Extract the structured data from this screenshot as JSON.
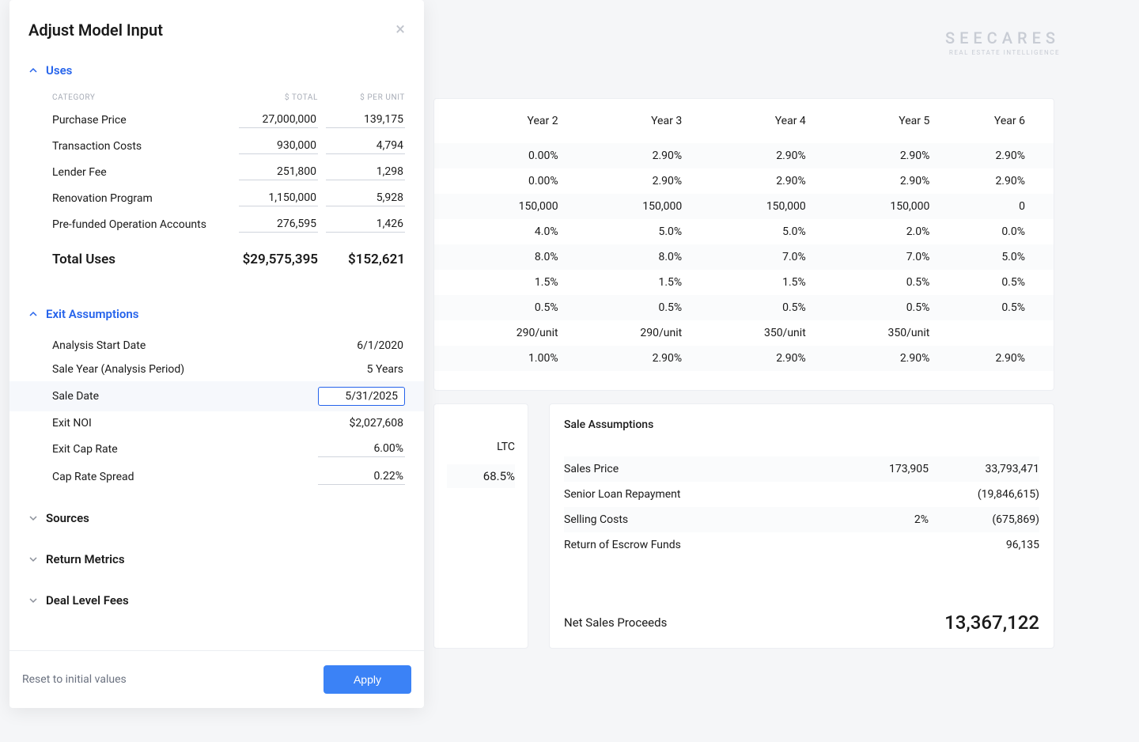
{
  "brand": {
    "name": "SEECARES",
    "tagline": "REAL ESTATE INTELLIGENCE"
  },
  "panel": {
    "title": "Adjust Model Input",
    "sections": {
      "uses": {
        "title": "Uses",
        "columns": {
          "cat": "CATEGORY",
          "total": "$ TOTAL",
          "per_unit": "$ PER UNIT"
        },
        "rows": [
          {
            "label": "Purchase Price",
            "total": "27,000,000",
            "per_unit": "139,175"
          },
          {
            "label": "Transaction Costs",
            "total": "930,000",
            "per_unit": "4,794"
          },
          {
            "label": "Lender Fee",
            "total": "251,800",
            "per_unit": "1,298"
          },
          {
            "label": "Renovation Program",
            "total": "1,150,000",
            "per_unit": "5,928"
          },
          {
            "label": "Pre-funded Operation Accounts",
            "total": "276,595",
            "per_unit": "1,426"
          }
        ],
        "total": {
          "label": "Total Uses",
          "total": "$29,575,395",
          "per_unit": "$152,621"
        }
      },
      "exit": {
        "title": "Exit Assumptions",
        "rows": [
          {
            "label": "Analysis Start Date",
            "value": "6/1/2020",
            "editable": false
          },
          {
            "label": "Sale Year (Analysis Period)",
            "value": "5 Years",
            "editable": false
          },
          {
            "label": "Sale Date",
            "value": "5/31/2025",
            "editable": true,
            "active": true
          },
          {
            "label": "Exit NOI",
            "value": "$2,027,608",
            "editable": false
          },
          {
            "label": "Exit Cap Rate",
            "value": "6.00%",
            "editable": true
          },
          {
            "label": "Cap Rate Spread",
            "value": "0.22%",
            "editable": true
          }
        ]
      },
      "sources": {
        "title": "Sources"
      },
      "return_metrics": {
        "title": "Return Metrics"
      },
      "deal_fees": {
        "title": "Deal Level Fees"
      }
    },
    "footer": {
      "reset": "Reset to initial values",
      "apply": "Apply"
    }
  },
  "annual": {
    "years": [
      "Year 2",
      "Year 3",
      "Year 4",
      "Year 5",
      "Year 6"
    ],
    "rows": [
      [
        "0.00%",
        "2.90%",
        "2.90%",
        "2.90%",
        "2.90%"
      ],
      [
        "0.00%",
        "2.90%",
        "2.90%",
        "2.90%",
        "2.90%"
      ],
      [
        "150,000",
        "150,000",
        "150,000",
        "150,000",
        "0"
      ],
      [
        "4.0%",
        "5.0%",
        "5.0%",
        "2.0%",
        "0.0%"
      ],
      [
        "8.0%",
        "8.0%",
        "7.0%",
        "7.0%",
        "5.0%"
      ],
      [
        "1.5%",
        "1.5%",
        "1.5%",
        "0.5%",
        "0.5%"
      ],
      [
        "0.5%",
        "0.5%",
        "0.5%",
        "0.5%",
        "0.5%"
      ],
      [
        "290/unit",
        "290/unit",
        "350/unit",
        "350/unit",
        ""
      ],
      [
        "1.00%",
        "2.90%",
        "2.90%",
        "2.90%",
        "2.90%"
      ]
    ]
  },
  "ltc": {
    "header": "LTC",
    "value": "68.5%"
  },
  "sale": {
    "title": "Sale Assumptions",
    "rows": [
      {
        "label": "Sales Price",
        "mid": "173,905",
        "val": "33,793,471"
      },
      {
        "label": "Senior Loan Repayment",
        "mid": "",
        "val": "(19,846,615)"
      },
      {
        "label": "Selling Costs",
        "mid": "2%",
        "val": "(675,869)"
      },
      {
        "label": "Return of Escrow Funds",
        "mid": "",
        "val": "96,135"
      }
    ],
    "net": {
      "label": "Net Sales Proceeds",
      "value": "13,367,122"
    }
  }
}
